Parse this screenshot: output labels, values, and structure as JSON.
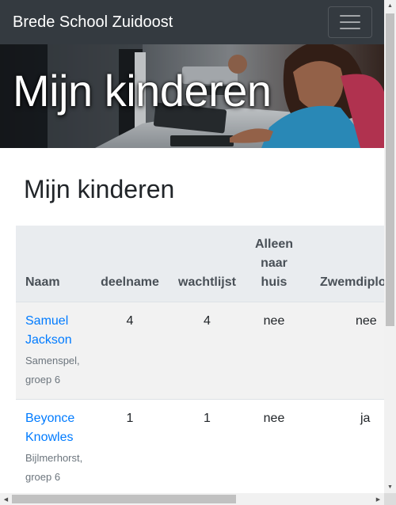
{
  "navbar": {
    "brand": "Brede School Zuidoost",
    "toggler_icon": "hamburger-icon"
  },
  "hero": {
    "title": "Mijn kinderen"
  },
  "main": {
    "title": "Mijn kinderen",
    "table": {
      "headers": {
        "naam": "Naam",
        "deelname": "deelname",
        "wachtlijst": "wachtlijst",
        "alleen_naar_huis": "Alleen naar huis",
        "zwemdiploma": "Zwemdiploma"
      },
      "rows": [
        {
          "naam": "Samuel Jackson",
          "school": "Samenspel,",
          "groep": "groep 6",
          "deelname": "4",
          "wachtlijst": "4",
          "alleen_naar_huis": "nee",
          "zwemdiploma": "nee"
        },
        {
          "naam": "Beyonce Knowles",
          "school": "Bijlmerhorst,",
          "groep": "groep 6",
          "deelname": "1",
          "wachtlijst": "1",
          "alleen_naar_huis": "nee",
          "zwemdiploma": "ja"
        }
      ]
    }
  },
  "colors": {
    "navbar_bg": "#343a40",
    "link": "#007bff",
    "table_header_bg": "#e9ecef",
    "striped_row_bg": "#f2f2f2"
  }
}
